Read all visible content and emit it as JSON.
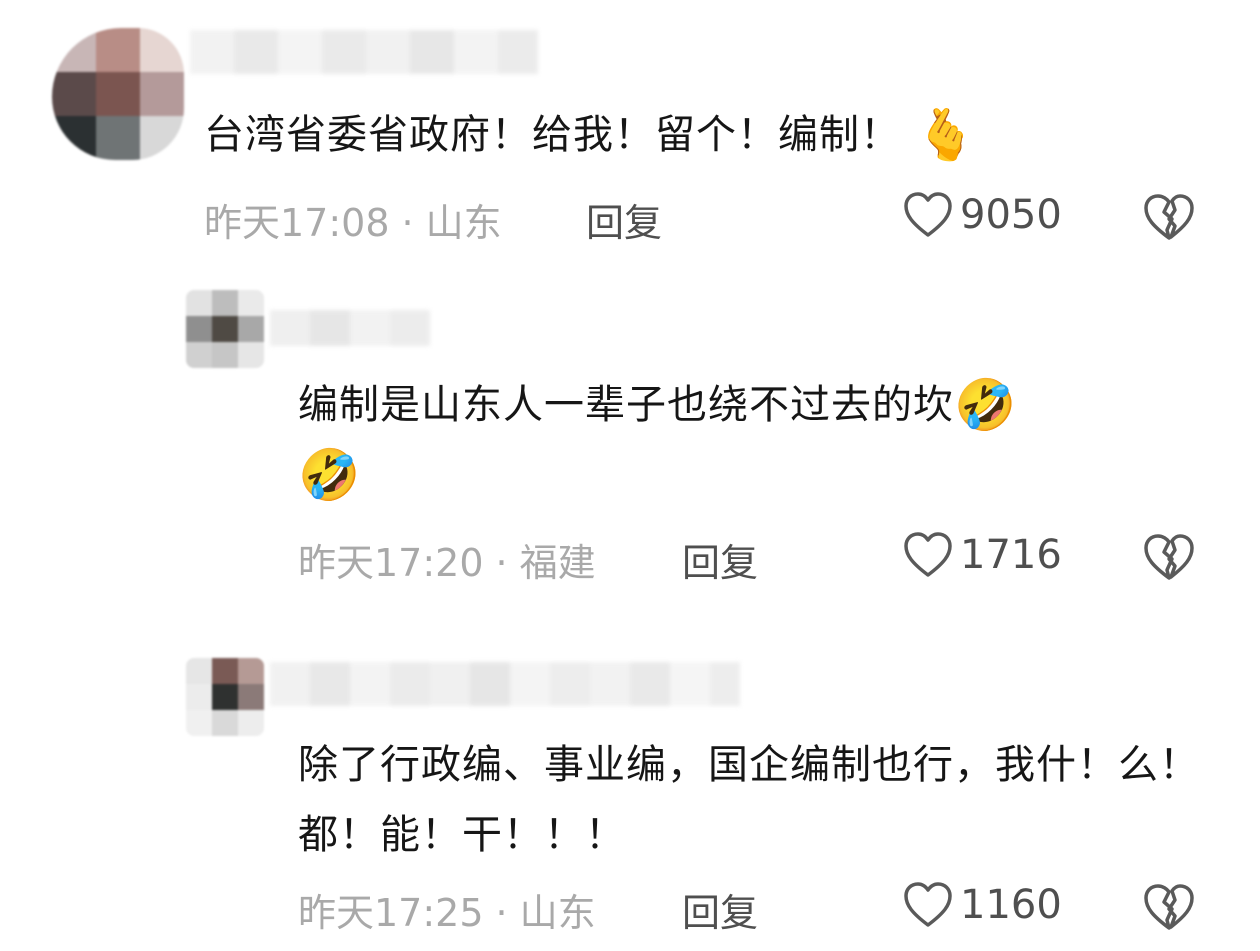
{
  "comments": [
    {
      "text": "台湾省委省政府！给我！留个！编制！",
      "emoji": "🫰",
      "time": "昨天17:08",
      "separator": "·",
      "location": "山东",
      "reply_label": "回复",
      "likes": "9050"
    },
    {
      "text": "编制是山东人一辈子也绕不过去的坎",
      "emoji": "🤣",
      "emoji2": "🤣",
      "time": "昨天17:20",
      "separator": "·",
      "location": "福建",
      "reply_label": "回复",
      "likes": "1716"
    },
    {
      "text": "除了行政编、事业编，国企编制也行，我什！么！都！能！干！！！",
      "time": "昨天17:25",
      "separator": "·",
      "location": "山东",
      "reply_label": "回复",
      "likes": "1160"
    }
  ],
  "icons": {
    "like": "heart-outline-icon",
    "dislike": "broken-heart-icon"
  },
  "colors": {
    "text": "#161616",
    "meta": "#a9a9a9",
    "action": "#4f4f4f"
  }
}
